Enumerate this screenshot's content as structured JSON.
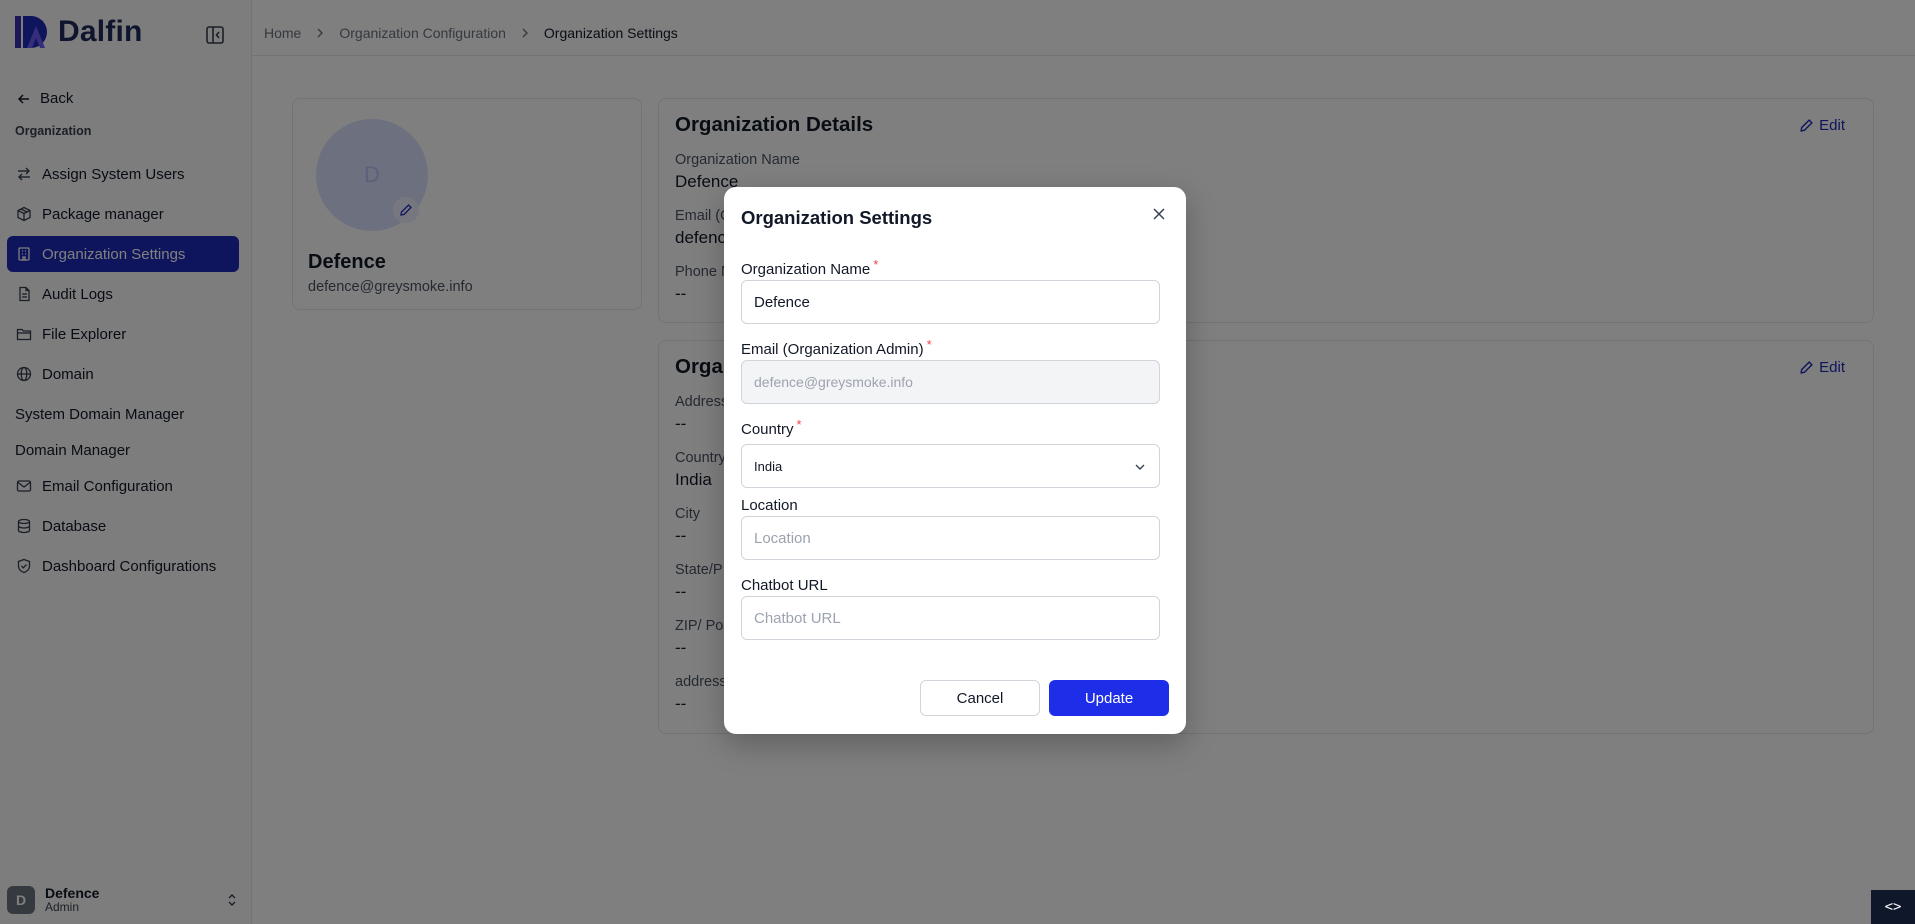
{
  "app": {
    "brand": "Dalfin"
  },
  "sidebar": {
    "back_label": "Back",
    "section_label": "Organization",
    "items": [
      {
        "label": "Assign System Users",
        "icon": "arrows-swap-icon"
      },
      {
        "label": "Package manager",
        "icon": "package-icon"
      },
      {
        "label": "Organization Settings",
        "icon": "building-icon",
        "active": true
      },
      {
        "label": "Audit Logs",
        "icon": "file-text-icon"
      },
      {
        "label": "File Explorer",
        "icon": "folder-icon"
      },
      {
        "label": "Domain",
        "icon": "globe-icon"
      }
    ],
    "plain_items": [
      "System Domain Manager",
      "Domain Manager"
    ],
    "items2": [
      {
        "label": "Email Configuration",
        "icon": "mail-icon"
      },
      {
        "label": "Database",
        "icon": "database-icon"
      },
      {
        "label": "Dashboard Configurations",
        "icon": "shield-icon"
      }
    ],
    "user": {
      "initial": "D",
      "name": "Defence",
      "role": "Admin"
    }
  },
  "breadcrumb": [
    "Home",
    "Organization Configuration",
    "Organization Settings"
  ],
  "profile": {
    "initial": "D",
    "name": "Defence",
    "email": "defence@greysmoke.info"
  },
  "org_details": {
    "title": "Organization Details",
    "edit_label": "Edit",
    "fields": [
      {
        "label": "Organization Name",
        "value": "Defence"
      },
      {
        "label": "Email (O",
        "value": "defenc"
      },
      {
        "label": "Phone N",
        "value": "--"
      }
    ]
  },
  "org_address": {
    "title": "Orga",
    "edit_label": "Edit",
    "fields": [
      {
        "label": "Address",
        "value": "--"
      },
      {
        "label": "Country",
        "value": "India"
      },
      {
        "label": "City",
        "value": "--"
      },
      {
        "label": "State/P",
        "value": "--"
      },
      {
        "label": "ZIP/ Po",
        "value": "--"
      },
      {
        "label": "address",
        "value": "--"
      }
    ]
  },
  "modal": {
    "title": "Organization Settings",
    "org_name_label": "Organization Name",
    "org_name_value": "Defence",
    "email_label": "Email (Organization Admin)",
    "email_value": "defence@greysmoke.info",
    "country_label": "Country",
    "country_value": "India",
    "location_label": "Location",
    "location_placeholder": "Location",
    "chatbot_label": "Chatbot URL",
    "chatbot_placeholder": "Chatbot URL",
    "required_mark": "*",
    "cancel_label": "Cancel",
    "update_label": "Update"
  },
  "dev_toggle": "<>",
  "colors": {
    "primary": "#1e2ee8",
    "active_nav": "#1e2ab8",
    "overlay": "rgba(0,0,0,0.5)"
  }
}
